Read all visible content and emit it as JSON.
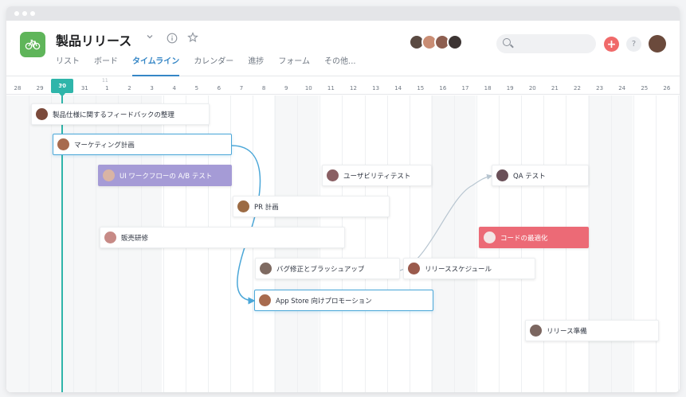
{
  "project": {
    "title": "製品リリース",
    "icon": "bicycle-icon",
    "colors": {
      "icon_bg": "#5fb55a",
      "accent": "#3586c6",
      "today": "#2fb5aa"
    }
  },
  "tabs": [
    {
      "label": "リスト",
      "active": false
    },
    {
      "label": "ボード",
      "active": false
    },
    {
      "label": "タイムライン",
      "active": true
    },
    {
      "label": "カレンダー",
      "active": false
    },
    {
      "label": "進捗",
      "active": false
    },
    {
      "label": "フォーム",
      "active": false
    },
    {
      "label": "その他...",
      "active": false
    }
  ],
  "timeline": {
    "month_label": "11",
    "today_label": "30",
    "days": [
      "28",
      "29",
      "30",
      "31",
      "1",
      "2",
      "3",
      "4",
      "5",
      "6",
      "7",
      "8",
      "9",
      "10",
      "11",
      "12",
      "13",
      "14",
      "15",
      "16",
      "17",
      "18",
      "19",
      "20",
      "21",
      "22",
      "23",
      "24",
      "25",
      "26"
    ]
  },
  "tasks": [
    {
      "id": "t1",
      "label": "製品仕様に関するフィードバックの整理",
      "style": "default"
    },
    {
      "id": "t2",
      "label": "マーケティング計画",
      "style": "selected"
    },
    {
      "id": "t3",
      "label": "UI ワークフローの A/B テスト",
      "style": "purple"
    },
    {
      "id": "t4",
      "label": "ユーザビリティテスト",
      "style": "default"
    },
    {
      "id": "t5",
      "label": "QA テスト",
      "style": "default"
    },
    {
      "id": "t6",
      "label": "PR 計画",
      "style": "default"
    },
    {
      "id": "t7",
      "label": "販売研修",
      "style": "default"
    },
    {
      "id": "t8",
      "label": "コードの最適化",
      "style": "red"
    },
    {
      "id": "t9",
      "label": "バグ修正とブラッシュアップ",
      "style": "default"
    },
    {
      "id": "t10",
      "label": "リリーススケジュール",
      "style": "default"
    },
    {
      "id": "t11",
      "label": "App Store 向けプロモーション",
      "style": "selected"
    },
    {
      "id": "t12",
      "label": "リリース準備",
      "style": "default"
    }
  ]
}
